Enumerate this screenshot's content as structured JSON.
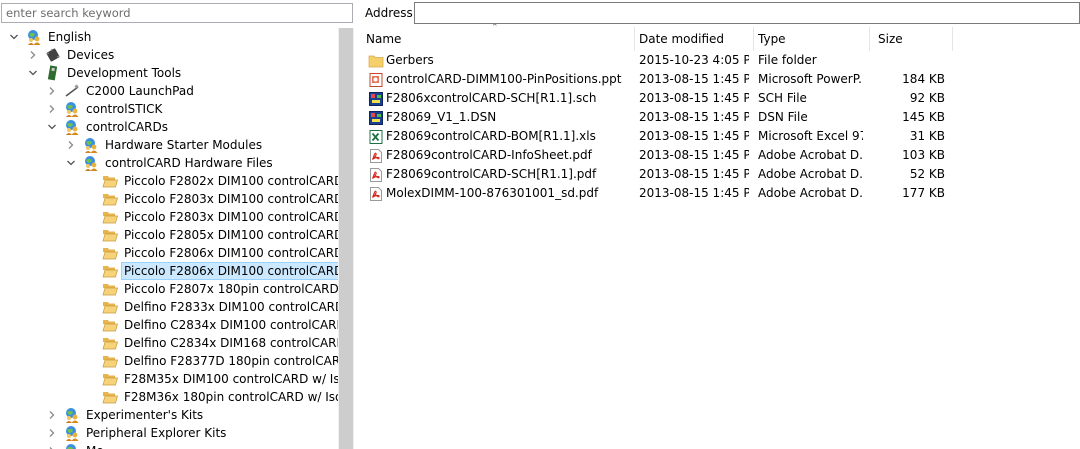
{
  "search": {
    "placeholder": "enter search keyword"
  },
  "tree": [
    {
      "label": "English",
      "level": 0,
      "expander": "open",
      "icon": "globe-people-icon"
    },
    {
      "label": "Devices",
      "level": 1,
      "expander": "closed",
      "icon": "chip-icon"
    },
    {
      "label": "Development Tools",
      "level": 1,
      "expander": "open",
      "icon": "board-icon"
    },
    {
      "label": "C2000 LaunchPad",
      "level": 2,
      "expander": "closed",
      "icon": "usb-stick-icon"
    },
    {
      "label": "controlSTICK",
      "level": 2,
      "expander": "closed",
      "icon": "globe-people-icon"
    },
    {
      "label": "controlCARDs",
      "level": 2,
      "expander": "open",
      "icon": "globe-people-icon"
    },
    {
      "label": "Hardware Starter Modules",
      "level": 3,
      "expander": "closed",
      "icon": "globe-people-icon"
    },
    {
      "label": "controlCARD Hardware Files",
      "level": 3,
      "expander": "open",
      "icon": "globe-people-icon"
    },
    {
      "label": "Piccolo F2802x DIM100 controlCARD",
      "level": 4,
      "expander": "none",
      "icon": "open-folder-icon"
    },
    {
      "label": "Piccolo F2803x DIM100 controlCARD",
      "level": 4,
      "expander": "none",
      "icon": "open-folder-icon"
    },
    {
      "label": "Piccolo F2803x DIM100 controlCARD w/ I",
      "level": 4,
      "expander": "none",
      "icon": "open-folder-icon"
    },
    {
      "label": "Piccolo F2805x DIM100 controlCARD w/ I",
      "level": 4,
      "expander": "none",
      "icon": "open-folder-icon"
    },
    {
      "label": "Piccolo F2806x DIM100 controlCARD w/ I",
      "level": 4,
      "expander": "none",
      "icon": "open-folder-icon"
    },
    {
      "label": "Piccolo F2806x DIM100 controlCARD",
      "level": 4,
      "expander": "none",
      "icon": "open-folder-icon",
      "selected": true
    },
    {
      "label": "Piccolo F2807x 180pin controlCARD w/ Is",
      "level": 4,
      "expander": "none",
      "icon": "open-folder-icon"
    },
    {
      "label": "Delfino F2833x DIM100 controlCARD",
      "level": 4,
      "expander": "none",
      "icon": "open-folder-icon"
    },
    {
      "label": "Delfino C2834x DIM100 controlCARD",
      "level": 4,
      "expander": "none",
      "icon": "open-folder-icon"
    },
    {
      "label": "Delfino C2834x DIM168 controlCARD",
      "level": 4,
      "expander": "none",
      "icon": "open-folder-icon"
    },
    {
      "label": "Delfino F28377D 180pin controlCARD w/",
      "level": 4,
      "expander": "none",
      "icon": "open-folder-icon"
    },
    {
      "label": "F28M35x DIM100 controlCARD w/ Isolate",
      "level": 4,
      "expander": "none",
      "icon": "open-folder-icon"
    },
    {
      "label": "F28M36x 180pin controlCARD w/ Isolatec",
      "level": 4,
      "expander": "none",
      "icon": "open-folder-icon"
    },
    {
      "label": "Experimenter's Kits",
      "level": 2,
      "expander": "closed",
      "icon": "globe-people-icon"
    },
    {
      "label": "Peripheral Explorer Kits",
      "level": 2,
      "expander": "closed",
      "icon": "globe-people-icon"
    },
    {
      "label": "Mo",
      "level": 2,
      "expander": "closed",
      "icon": "globe-people-icon"
    }
  ],
  "address": {
    "label": "Address:",
    "value": ""
  },
  "columns": {
    "name": "Name",
    "date": "Date modified",
    "type": "Type",
    "size": "Size"
  },
  "files": [
    {
      "name": "Gerbers",
      "date": "2015-10-23 4:05 PM",
      "type": "File folder",
      "size": "",
      "icon": "folder-icon"
    },
    {
      "name": "controlCARD-DIMM100-PinPositions.ppt",
      "date": "2013-08-15 1:45 PM",
      "type": "Microsoft PowerP...",
      "size": "184 KB",
      "icon": "powerpoint-file-icon"
    },
    {
      "name": "F2806xcontrolCARD-SCH[R1.1].sch",
      "date": "2013-08-15 1:45 PM",
      "type": "SCH File",
      "size": "92 KB",
      "icon": "schematic-file-icon"
    },
    {
      "name": "F28069_V1_1.DSN",
      "date": "2013-08-15 1:45 PM",
      "type": "DSN File",
      "size": "145 KB",
      "icon": "schematic-file-icon"
    },
    {
      "name": "F28069controlCARD-BOM[R1.1].xls",
      "date": "2013-08-15 1:45 PM",
      "type": "Microsoft Excel 97...",
      "size": "31 KB",
      "icon": "excel-file-icon"
    },
    {
      "name": "F28069controlCARD-InfoSheet.pdf",
      "date": "2013-08-15 1:45 PM",
      "type": "Adobe Acrobat D...",
      "size": "103 KB",
      "icon": "pdf-file-icon"
    },
    {
      "name": "F28069controlCARD-SCH[R1.1].pdf",
      "date": "2013-08-15 1:45 PM",
      "type": "Adobe Acrobat D...",
      "size": "52 KB",
      "icon": "pdf-file-icon"
    },
    {
      "name": "MolexDIMM-100-876301001_sd.pdf",
      "date": "2013-08-15 1:45 PM",
      "type": "Adobe Acrobat D...",
      "size": "177 KB",
      "icon": "pdf-file-icon"
    }
  ]
}
